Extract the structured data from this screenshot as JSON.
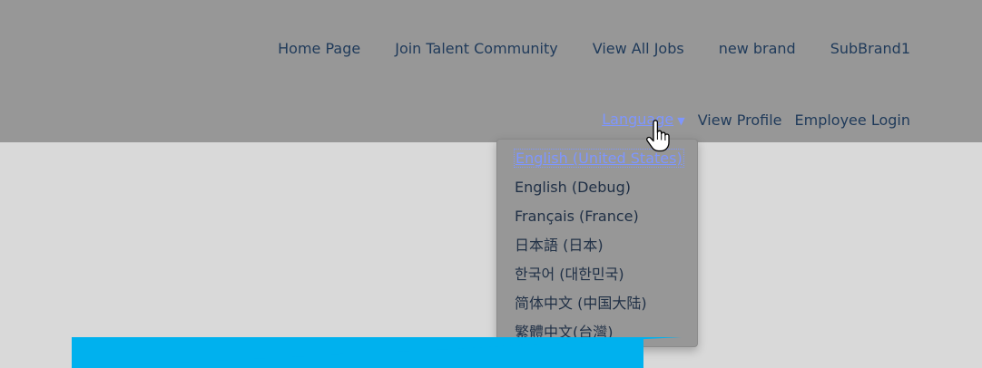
{
  "nav": {
    "main": [
      {
        "label": "Home Page"
      },
      {
        "label": "Join Talent Community"
      },
      {
        "label": "View All Jobs"
      },
      {
        "label": "new brand"
      },
      {
        "label": "SubBrand1"
      }
    ],
    "secondary": {
      "language_label": "Language",
      "view_profile_label": "View Profile",
      "employee_login_label": "Employee Login"
    }
  },
  "language_dropdown": {
    "items": [
      {
        "label": "English (United States)"
      },
      {
        "label": "English (Debug)"
      },
      {
        "label": "Français (France)"
      },
      {
        "label": "日本語 (日本)"
      },
      {
        "label": "한국어 (대한민국)"
      },
      {
        "label": "简体中文 (中国大陆)"
      },
      {
        "label": "繁體中文(台灣)"
      }
    ],
    "selected_index": 0
  },
  "colors": {
    "header_bg": "#979797",
    "body_bg": "#d9d9d9",
    "link": "#1f3a5a",
    "accent_link": "#7e96ff",
    "banner": "#00b1ee"
  },
  "icons": {
    "caret": "caret-down-icon",
    "pointer": "hand-pointer-icon"
  }
}
